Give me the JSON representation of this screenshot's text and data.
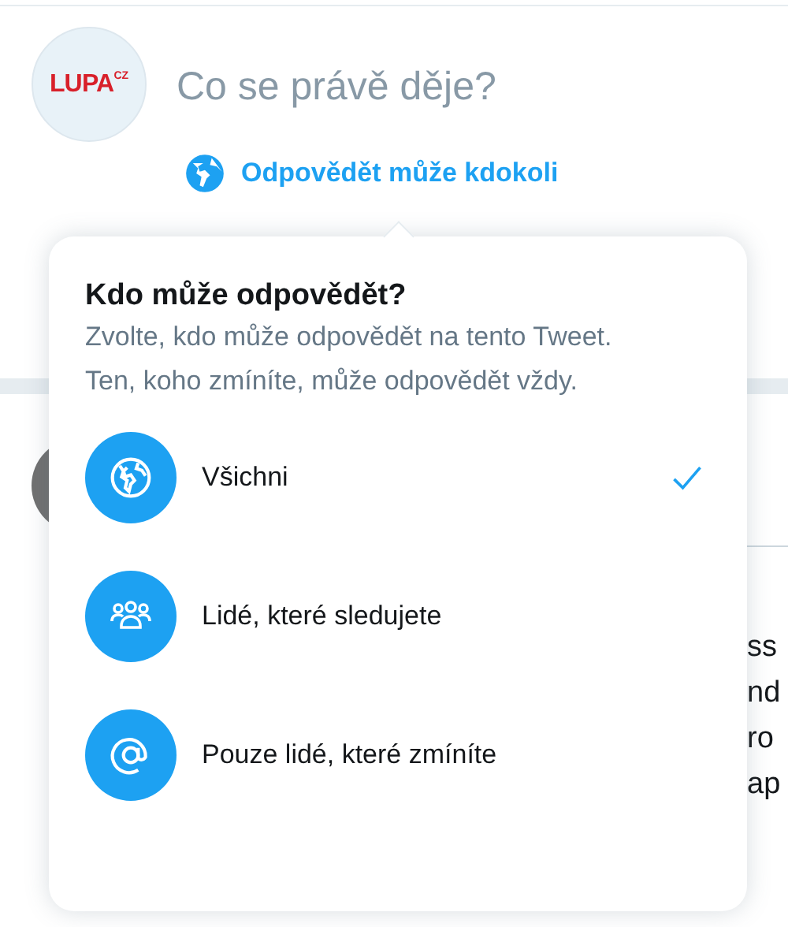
{
  "composer": {
    "avatar_logo": {
      "text": "LUPA",
      "suffix": "CZ"
    },
    "placeholder": "Co se právě děje?",
    "reply_setting": "Odpovědět může kdokoli"
  },
  "feed": {
    "fragments": [
      "ss",
      "nd",
      "ro",
      "ap"
    ]
  },
  "popup": {
    "title": "Kdo může odpovědět?",
    "description": "Zvolte, kdo může odpovědět na tento Tweet. Ten, koho zmíníte, může odpovědět vždy.",
    "options": [
      {
        "kind": "globe",
        "label": "Všichni",
        "selected": true
      },
      {
        "kind": "people",
        "label": "Lidé, které sledujete",
        "selected": false
      },
      {
        "kind": "mention",
        "label": "Pouze lidé, které zmíníte",
        "selected": false
      }
    ]
  }
}
